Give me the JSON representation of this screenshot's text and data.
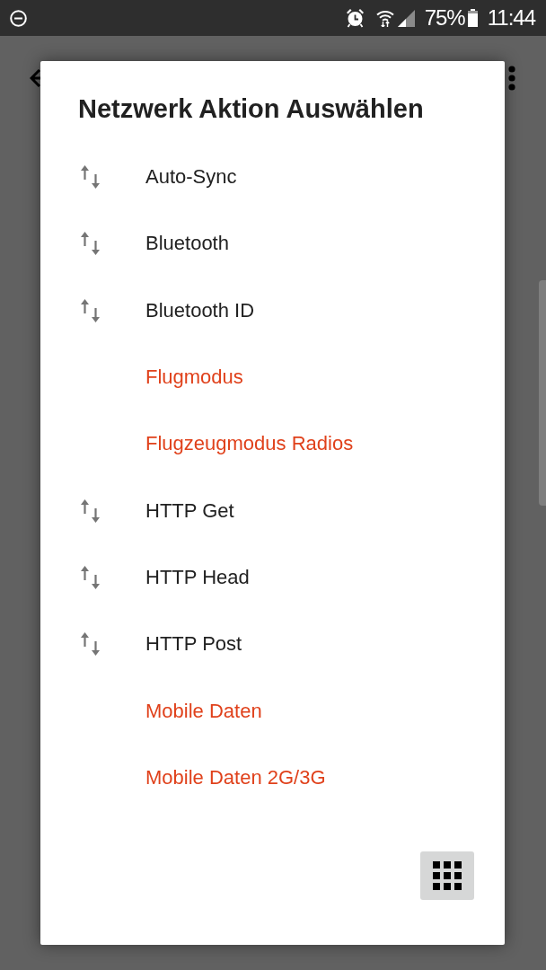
{
  "status_bar": {
    "battery": "75%",
    "time": "11:44"
  },
  "dialog": {
    "title": "Netzwerk Aktion Auswählen",
    "items": [
      {
        "label": "Auto-Sync",
        "kind": "standard"
      },
      {
        "label": "Bluetooth",
        "kind": "standard"
      },
      {
        "label": "Bluetooth ID",
        "kind": "standard"
      },
      {
        "label": "Flugmodus",
        "kind": "restricted"
      },
      {
        "label": "Flugzeugmodus Radios",
        "kind": "restricted"
      },
      {
        "label": "HTTP Get",
        "kind": "standard"
      },
      {
        "label": "HTTP Head",
        "kind": "standard"
      },
      {
        "label": "HTTP Post",
        "kind": "standard"
      },
      {
        "label": "Mobile Daten",
        "kind": "restricted"
      },
      {
        "label": "Mobile Daten 2G/3G",
        "kind": "restricted"
      }
    ]
  }
}
